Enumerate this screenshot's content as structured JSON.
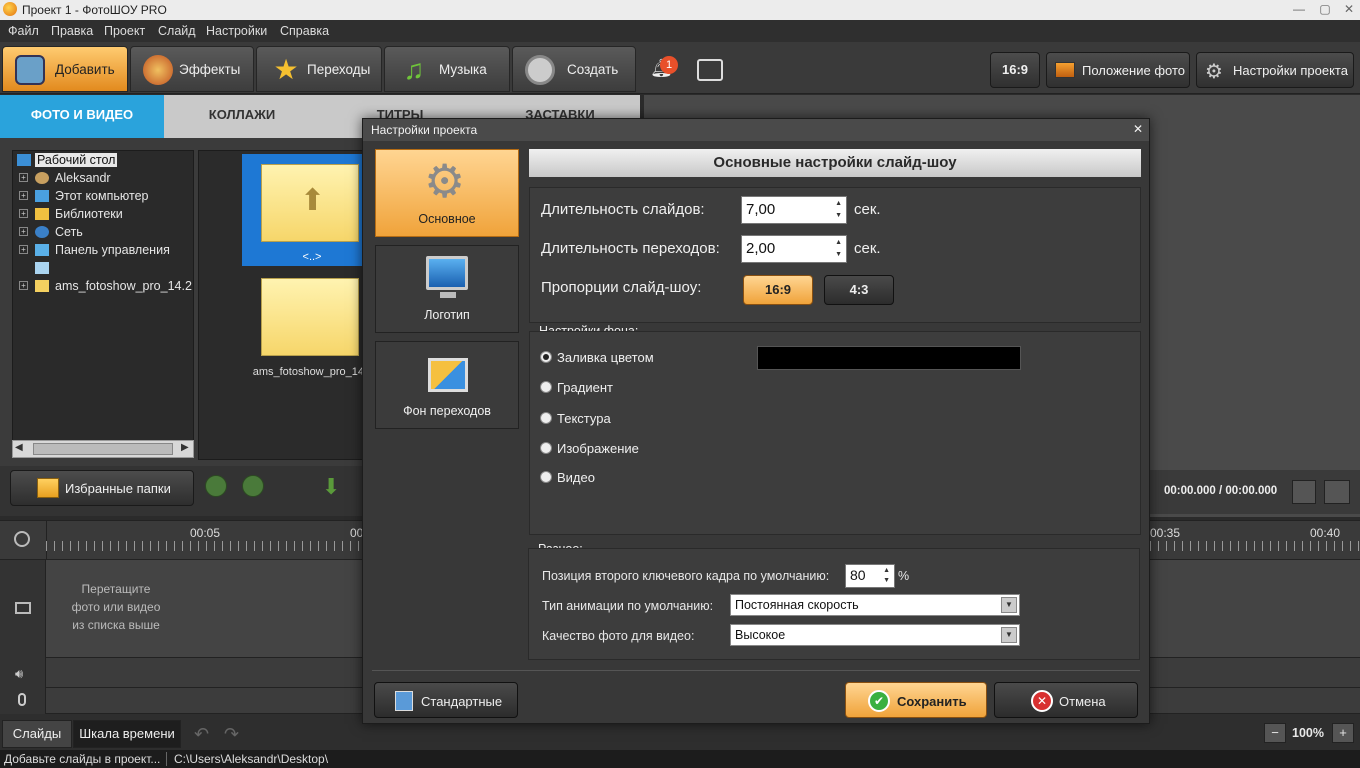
{
  "window": {
    "title": "Проект 1 - ФотоШОУ PRO",
    "minimize": "—",
    "maximize": "▢",
    "close": "✕"
  },
  "menu": [
    "Файл",
    "Правка",
    "Проект",
    "Слайд",
    "Настройки",
    "Справка"
  ],
  "toolbar": {
    "tabs": [
      {
        "label": "Добавить",
        "icon": "camera-icon"
      },
      {
        "label": "Эффекты",
        "icon": "palette-icon"
      },
      {
        "label": "Переходы",
        "icon": "star-icon"
      },
      {
        "label": "Музыка",
        "icon": "music-icon"
      },
      {
        "label": "Создать",
        "icon": "film-reel-icon"
      }
    ],
    "notification_count": "1",
    "ratio_button": "16:9",
    "photo_position_button": "Положение фото",
    "project_settings_button": "Настройки проекта"
  },
  "subtabs": [
    "ФОТО И ВИДЕО",
    "КОЛЛАЖИ",
    "ТИТРЫ",
    "ЗАСТАВКИ"
  ],
  "tree": [
    {
      "label": "Рабочий стол",
      "icon": "desktop-icon",
      "expander": ""
    },
    {
      "label": "Aleksandr",
      "icon": "user-folder-icon",
      "expander": "+"
    },
    {
      "label": "Этот компьютер",
      "icon": "computer-icon",
      "expander": "+"
    },
    {
      "label": "Библиотеки",
      "icon": "library-icon",
      "expander": "+"
    },
    {
      "label": "Сеть",
      "icon": "network-icon",
      "expander": "+"
    },
    {
      "label": "Панель управления",
      "icon": "control-panel-icon",
      "expander": "+"
    },
    {
      "label": "",
      "icon": "recycle-bin-icon",
      "expander": ""
    },
    {
      "label": "ams_fotoshow_pro_14.2",
      "icon": "folder-icon",
      "expander": "+"
    }
  ],
  "files": [
    {
      "label": "<..>"
    },
    {
      "label": "ams_fotoshow_pro_14"
    }
  ],
  "favorites_button": "Избранные папки",
  "player": {
    "time": "00:00.000 / 00:00.000"
  },
  "ruler": {
    "ticks": [
      "00:05",
      "00",
      "00:35",
      "00:40"
    ]
  },
  "track": {
    "hint_line1": "Перетащите",
    "hint_line2": "фото или видео",
    "hint_line3": "из списка выше"
  },
  "bottom": {
    "slides_tab": "Слайды",
    "timeline_tab": "Шкала времени",
    "zoom": "100%"
  },
  "status": {
    "left": "Добавьте слайды в проект...",
    "path": "C:\\Users\\Aleksandr\\Desktop\\"
  },
  "dialog": {
    "title": "Настройки проекта",
    "nav": [
      {
        "label": "Основное",
        "icon": "gear-icon"
      },
      {
        "label": "Логотип",
        "icon": "monitor-logo-icon"
      },
      {
        "label": "Фон переходов",
        "icon": "transition-bg-icon"
      }
    ],
    "header": "Основные настройки слайд-шоу",
    "slide_duration_label": "Длительность слайдов:",
    "slide_duration_value": "7,00",
    "transition_duration_label": "Длительность переходов:",
    "transition_duration_value": "2,00",
    "unit": "сек.",
    "proportions_label": "Пропорции слайд-шоу:",
    "ratio_169": "16:9",
    "ratio_43": "4:3",
    "bg_section": "Настройки фона:",
    "bg_options": [
      "Заливка цветом",
      "Градиент",
      "Текстура",
      "Изображение",
      "Видео"
    ],
    "bg_selected": "Заливка цветом",
    "bg_color": "#000000",
    "misc_section": "Разное:",
    "keyframe_label": "Позиция второго ключевого кадра по умолчанию:",
    "keyframe_value": "80",
    "percent": "%",
    "animation_label": "Тип анимации по умолчанию:",
    "animation_value": "Постоянная скорость",
    "quality_label": "Качество фото для видео:",
    "quality_value": "Высокое",
    "defaults_button": "Стандартные",
    "save_button": "Сохранить",
    "cancel_button": "Отмена",
    "close": "✕"
  }
}
